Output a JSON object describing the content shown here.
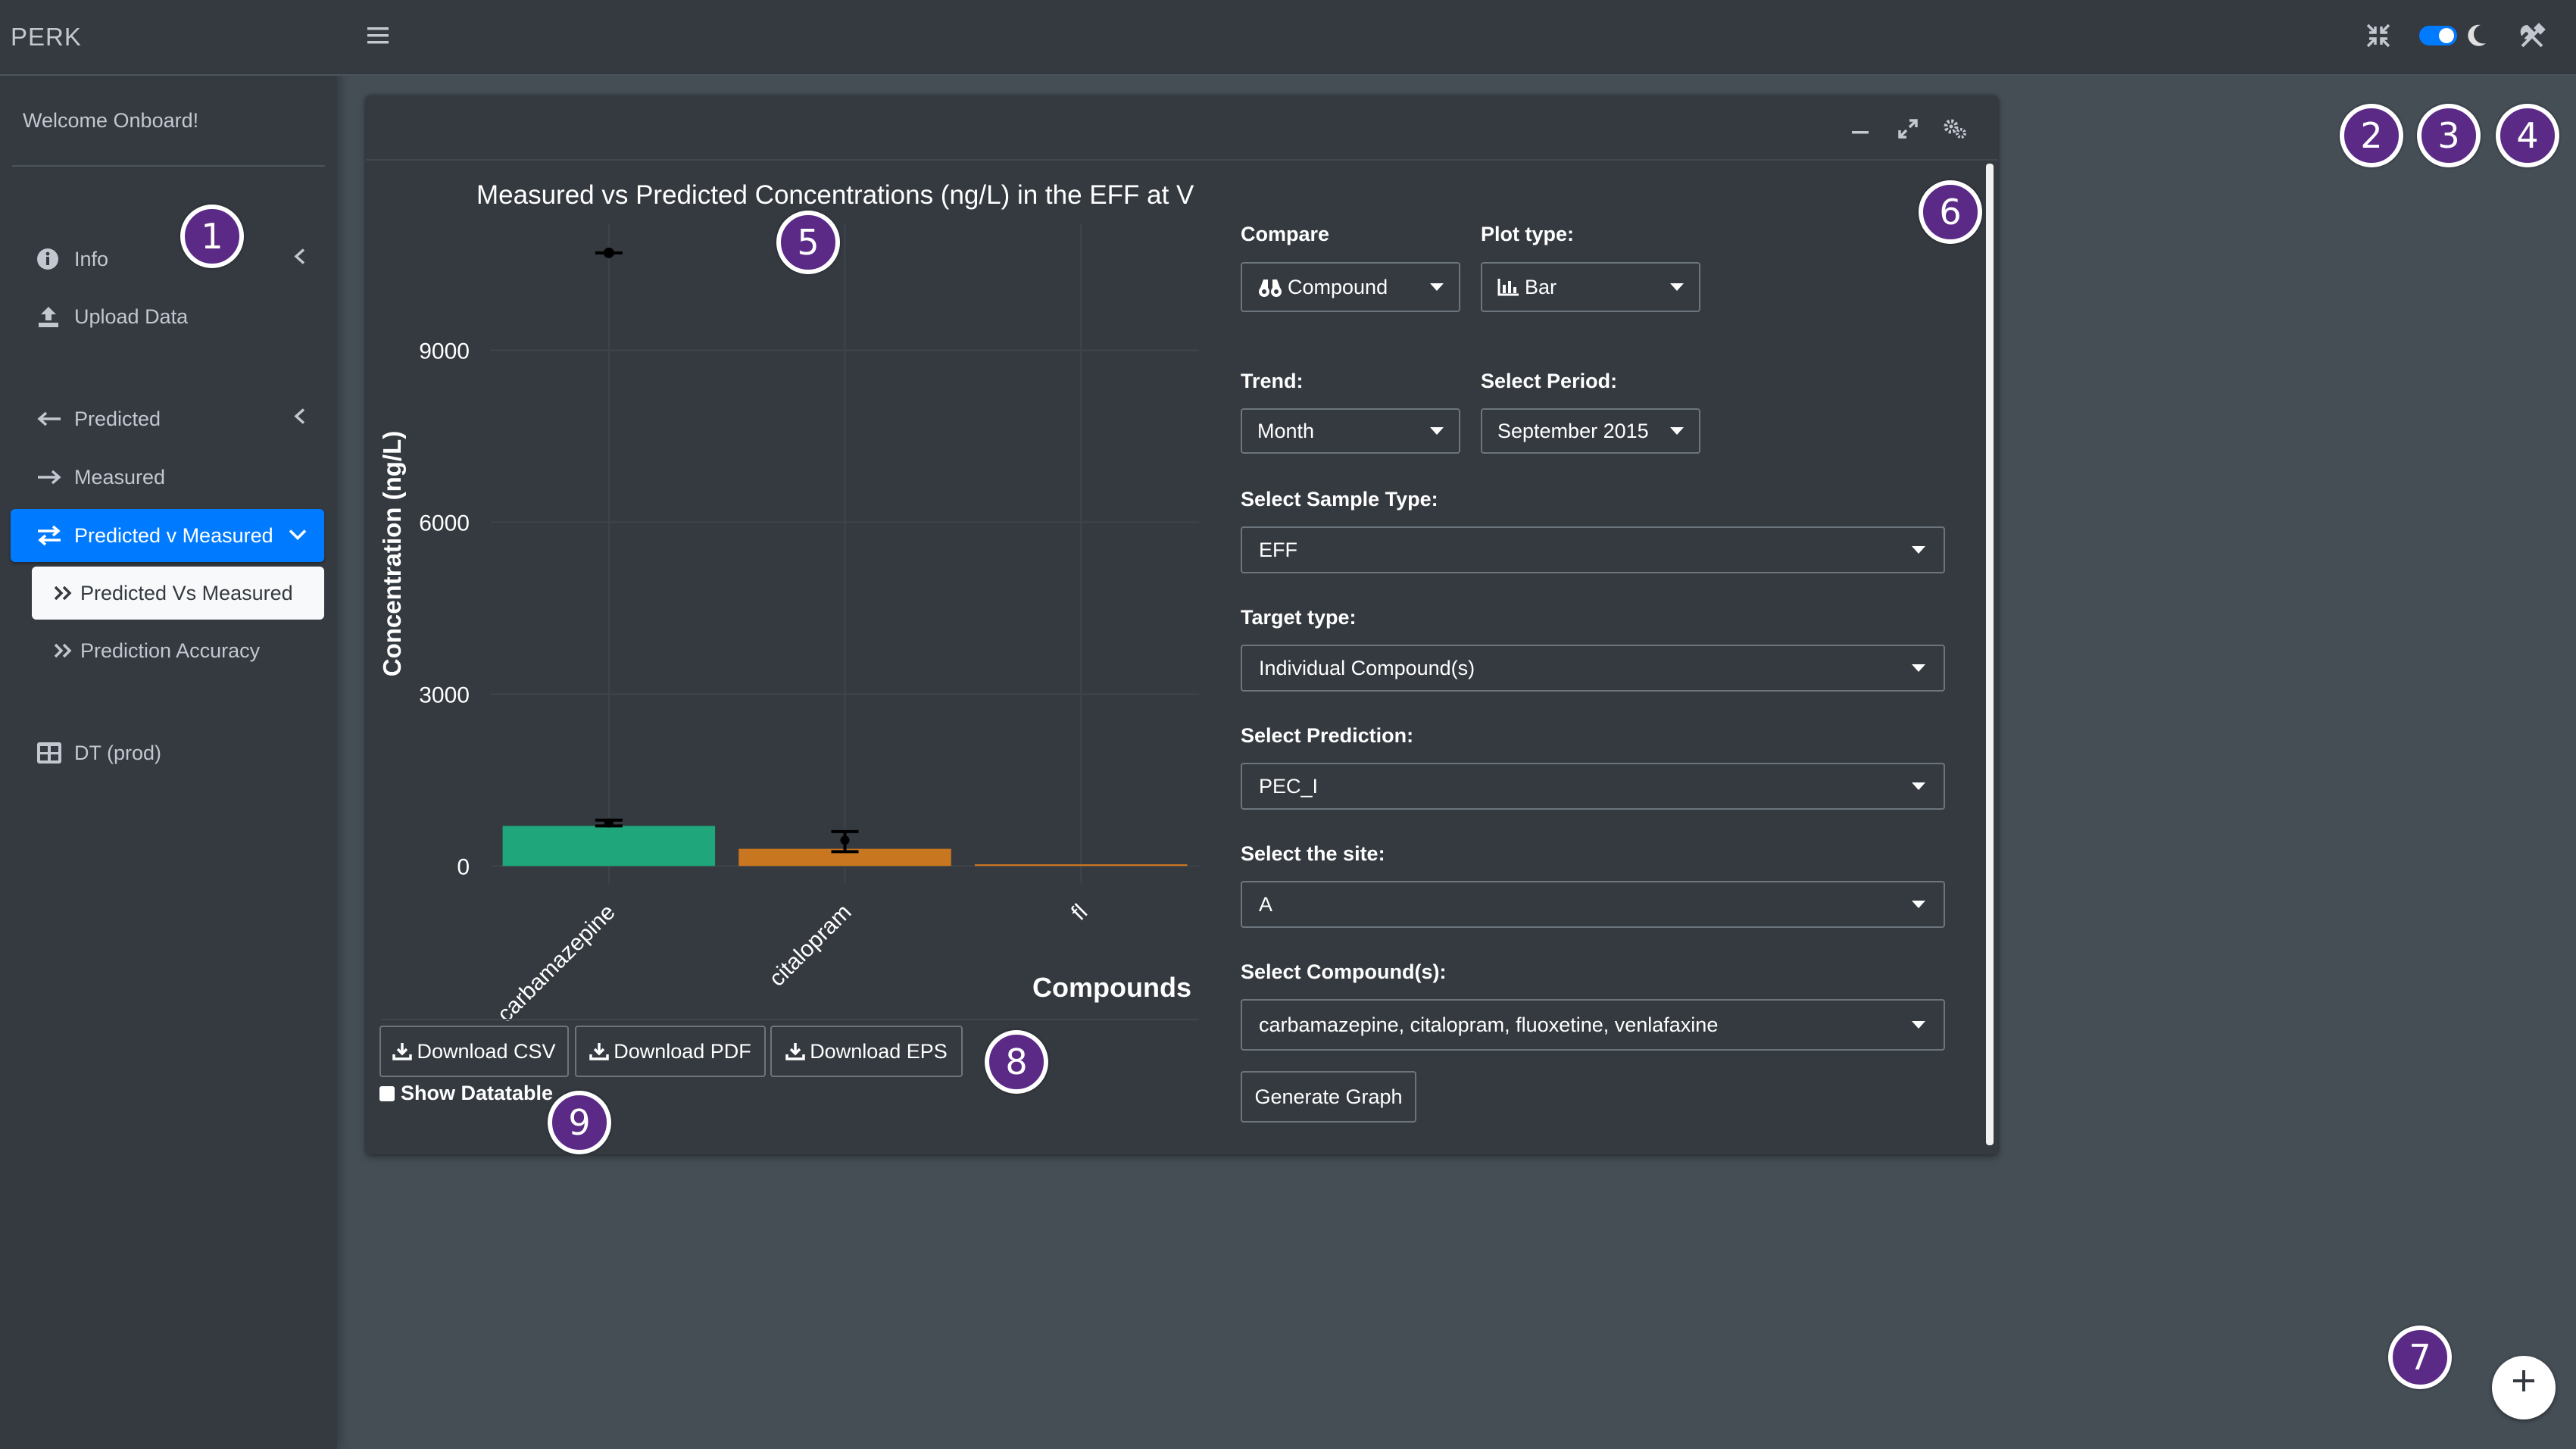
{
  "app": {
    "brand": "PERK"
  },
  "sidebar": {
    "welcome": "Welcome Onboard!",
    "items": [
      {
        "label": "Info",
        "icon": "info-circle-icon"
      },
      {
        "label": "Upload Data",
        "icon": "upload-icon"
      },
      {
        "label": "Predicted",
        "icon": "arrow-left-icon"
      },
      {
        "label": "Measured",
        "icon": "arrow-right-icon"
      },
      {
        "label": "Predicted v Measured",
        "icon": "exchange-icon"
      },
      {
        "label": "Predicted Vs Measured",
        "icon": "double-chevron-right-icon"
      },
      {
        "label": "Prediction Accuracy",
        "icon": "double-chevron-right-icon"
      },
      {
        "label": "DT (prod)",
        "icon": "table-icon"
      }
    ]
  },
  "header": {
    "icons": [
      "hamburger-icon",
      "fullscreen-icon",
      "dark-mode-toggle",
      "moon-icon",
      "tools-icon"
    ]
  },
  "colors": {
    "accent": "#007bff",
    "bar_carbamazepine": "#1fa67a",
    "bar_citalopram": "#c8761f",
    "badge": "#5b2a86"
  },
  "chart_data": {
    "type": "bar",
    "title": "Measured vs Predicted Concentrations (ng/L) in the  EFF  at V",
    "xlabel": "Compounds",
    "ylabel": "Concentration (ng/L)",
    "categories": [
      "carbamazepine",
      "citalopram",
      "fl"
    ],
    "values": [
      700,
      300,
      30
    ],
    "error_bars": [
      {
        "category": "carbamazepine",
        "center": 750,
        "low": 700,
        "high": 800
      },
      {
        "category": "citalopram",
        "center": 450,
        "low": 250,
        "high": 600
      }
    ],
    "extra_points": [
      {
        "category": "carbamazepine",
        "value": 10700
      }
    ],
    "yticks": [
      0,
      3000,
      6000,
      9000
    ],
    "ylim": [
      -300,
      11200
    ],
    "grid": true
  },
  "buttons": {
    "download_csv": "Download CSV",
    "download_pdf": "Download PDF",
    "download_eps": "Download EPS",
    "show_datatable": "Show Datatable",
    "generate_graph": "Generate Graph"
  },
  "form": {
    "compare_label": "Compare",
    "compare_value": "Compound",
    "plot_type_label": "Plot type:",
    "plot_type_value": "Bar",
    "trend_label": "Trend:",
    "trend_value": "Month",
    "period_label": "Select Period:",
    "period_value": "September 2015",
    "sample_type_label": "Select Sample Type:",
    "sample_type_value": "EFF",
    "target_type_label": "Target type:",
    "target_type_value": "Individual Compound(s)",
    "prediction_label": "Select Prediction:",
    "prediction_value": "PEC_I",
    "site_label": "Select the site:",
    "site_value": "A",
    "compounds_label": "Select Compound(s):",
    "compounds_value": "carbamazepine, citalopram, fluoxetine, venlafaxine"
  },
  "badges": [
    "1",
    "2",
    "3",
    "4",
    "5",
    "6",
    "7",
    "8",
    "9"
  ]
}
